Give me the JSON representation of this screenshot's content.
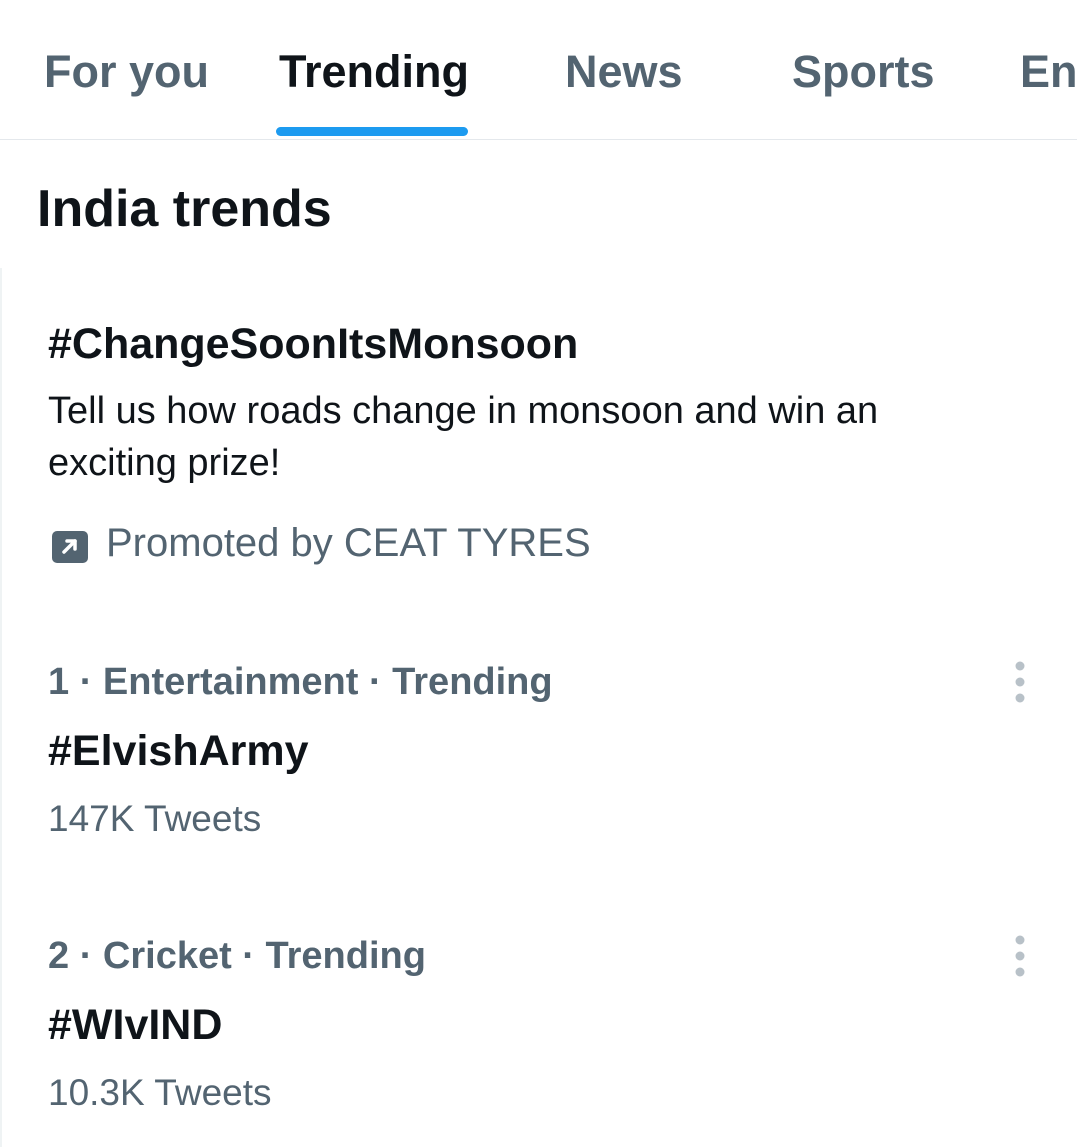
{
  "tabs": [
    {
      "label": "For you",
      "active": false
    },
    {
      "label": "Trending",
      "active": true
    },
    {
      "label": "News",
      "active": false
    },
    {
      "label": "Sports",
      "active": false
    },
    {
      "label": "Ent",
      "active": false
    }
  ],
  "section": {
    "title": "India trends"
  },
  "promoted": {
    "hashtag": "#ChangeSoonItsMonsoon",
    "description": "Tell us how roads change in monsoon and win an exciting prize!",
    "promoted_by": "Promoted by CEAT TYRES",
    "icon": "promoted-arrow-icon"
  },
  "trends": [
    {
      "meta": "1 · Entertainment · Trending",
      "name": "#ElvishArmy",
      "count": "147K Tweets",
      "menu_icon": "more-vertical-icon"
    },
    {
      "meta": "2 · Cricket · Trending",
      "name": "#WIvIND",
      "count": "10.3K Tweets",
      "menu_icon": "more-vertical-icon"
    }
  ],
  "colors": {
    "accent": "#1d9bf0",
    "primary_text": "#0f1419",
    "secondary_text": "#536471",
    "divider": "#e4e8ec"
  }
}
